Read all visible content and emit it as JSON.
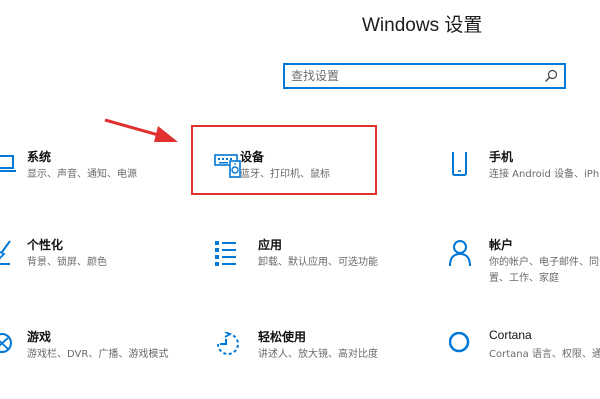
{
  "window": {
    "title": "Windows 设置"
  },
  "search": {
    "placeholder": "查找设置"
  },
  "tiles": [
    {
      "name": "系统",
      "desc": "显示、声音、通知、电源",
      "icon": "laptop-icon"
    },
    {
      "name": "设备",
      "desc": "蓝牙、打印机、鼠标",
      "icon": "keyboard-device-icon"
    },
    {
      "name": "手机",
      "desc": "连接 Android 设备、iPh",
      "icon": "phone-icon"
    },
    {
      "name": "个性化",
      "desc": "背景、锁屏、颜色",
      "icon": "paintbrush-icon"
    },
    {
      "name": "应用",
      "desc": "卸载、默认应用、可选功能",
      "icon": "apps-list-icon"
    },
    {
      "name": "帐户",
      "desc": "你的帐户、电子邮件、同步设",
      "desc2": "置、工作、家庭",
      "icon": "person-icon"
    },
    {
      "name": "游戏",
      "desc": "游戏栏、DVR、广播、游戏模式",
      "icon": "xbox-icon"
    },
    {
      "name": "轻松使用",
      "desc": "讲述人、放大镜、高对比度",
      "icon": "ease-of-access-icon"
    },
    {
      "name": "Cortana",
      "desc": "Cortana 语言、权限、通知",
      "icon": "cortana-ring-icon"
    }
  ],
  "colors": {
    "accent": "#0078d7",
    "highlight": "#e03030"
  }
}
